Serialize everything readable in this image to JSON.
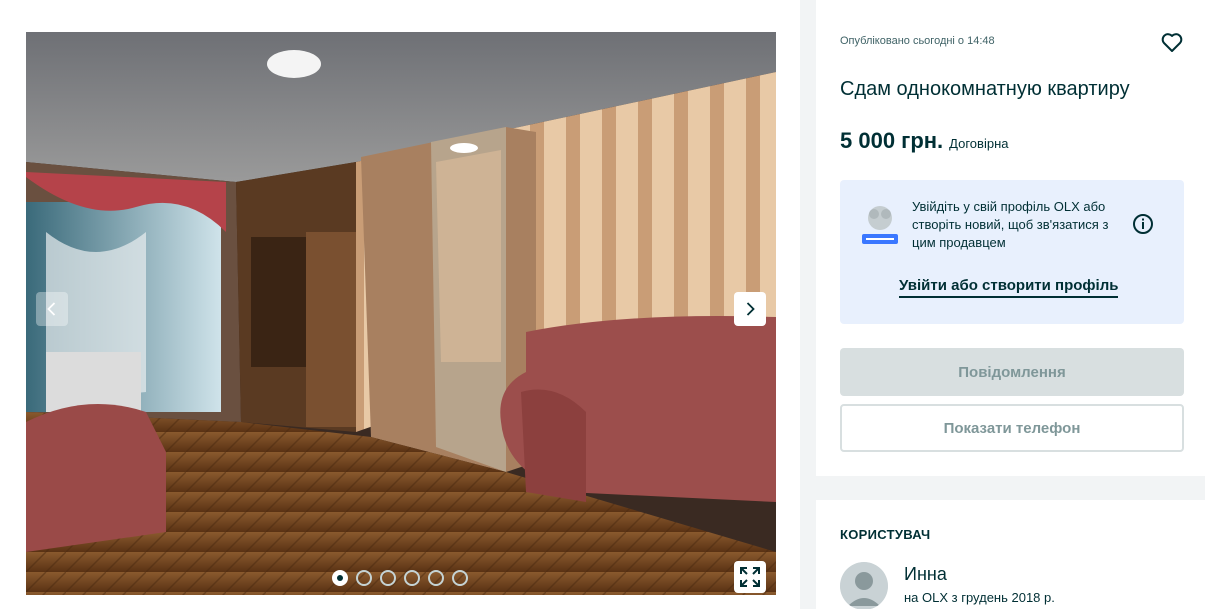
{
  "gallery": {
    "photo_alt": "Квартира",
    "photo_count": 6,
    "active_index": 0
  },
  "listing": {
    "posted": "Опубліковано сьогодні о 14:48",
    "title": "Сдам однокомнатную квартиру",
    "price": "5 000 грн.",
    "negotiable": "Договірна"
  },
  "login_prompt": {
    "text": "Увійдіть у свій профіль OLX або створіть новий, щоб зв'язатися з цим продавцем",
    "link_label": "Увійти або створити профіль"
  },
  "actions": {
    "message_label": "Повідомлення",
    "phone_label": "Показати телефон"
  },
  "user": {
    "heading": "КОРИСТУВАЧ",
    "name": "Инна",
    "since": "на OLX з грудень 2018 р."
  },
  "icons": {
    "prev": "chevron-left-icon",
    "next": "chevron-right-icon",
    "fullscreen": "expand-icon",
    "favorite": "heart-icon",
    "info": "info-icon"
  },
  "colors": {
    "brand_dark": "#002f34",
    "login_bg": "#e8f0fd",
    "disabled_btn": "#d8dfe0"
  }
}
